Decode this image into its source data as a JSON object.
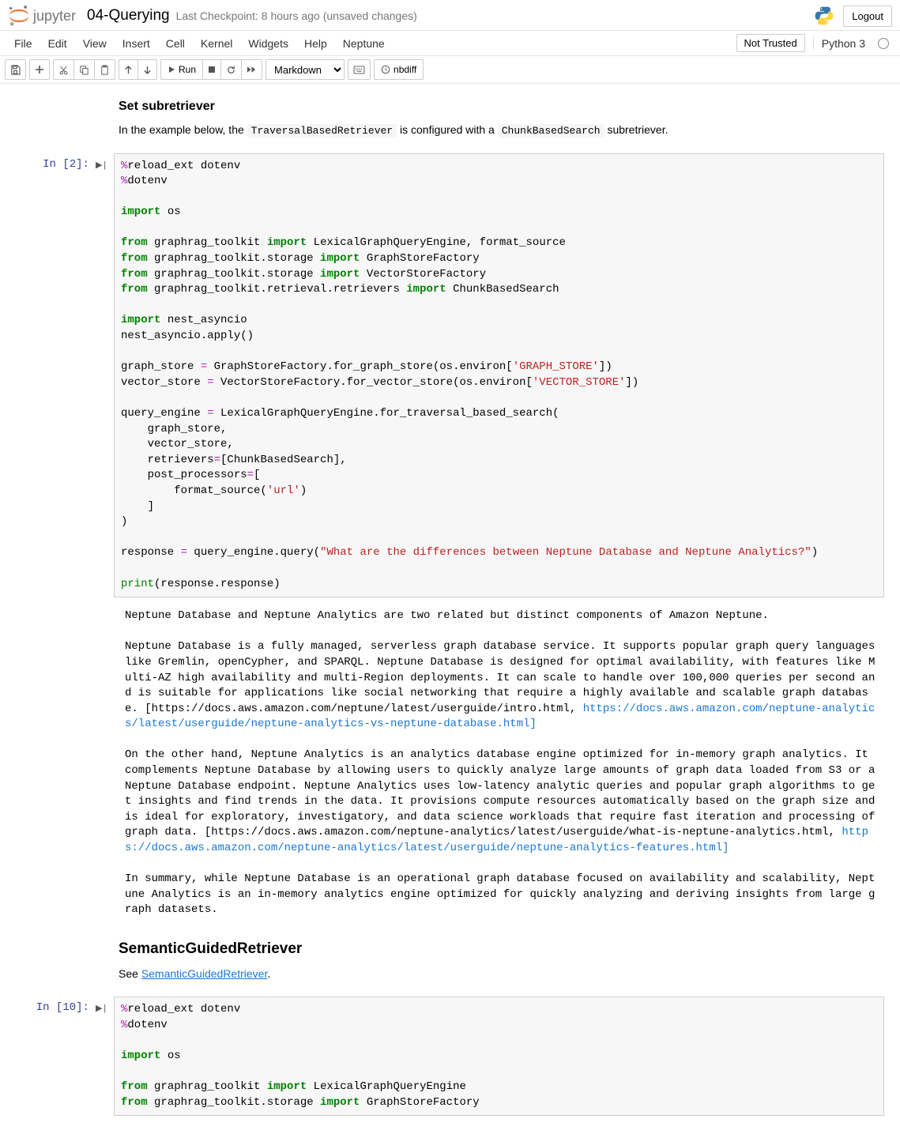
{
  "header": {
    "jupyter": "jupyter",
    "title": "04-Querying",
    "checkpoint": "Last Checkpoint: 8 hours ago",
    "unsaved": "(unsaved changes)",
    "logout": "Logout"
  },
  "menubar": {
    "items": [
      "File",
      "Edit",
      "View",
      "Insert",
      "Cell",
      "Kernel",
      "Widgets",
      "Help",
      "Neptune"
    ],
    "trust": "Not Trusted",
    "kernel": "Python 3"
  },
  "toolbar": {
    "run": "Run",
    "cell_type": "Markdown",
    "nbdiff": "nbdiff"
  },
  "md1": {
    "heading": "Set subretriever",
    "p1a": "In the example below, the ",
    "p1b": "TraversalBasedRetriever",
    "p1c": " is configured with a ",
    "p1d": "ChunkBasedSearch",
    "p1e": " subretriever."
  },
  "cell2": {
    "prompt": "In [2]:",
    "code": {
      "l1a": "%",
      "l1b": "reload_ext dotenv",
      "l2a": "%",
      "l2b": "dotenv",
      "l3a": "import",
      "l3b": " os",
      "l4a": "from",
      "l4b": " graphrag_toolkit ",
      "l4c": "import",
      "l4d": " LexicalGraphQueryEngine, format_source",
      "l5a": "from",
      "l5b": " graphrag_toolkit.storage ",
      "l5c": "import",
      "l5d": " GraphStoreFactory",
      "l6a": "from",
      "l6b": " graphrag_toolkit.storage ",
      "l6c": "import",
      "l6d": " VectorStoreFactory",
      "l7a": "from",
      "l7b": " graphrag_toolkit.retrieval.retrievers ",
      "l7c": "import",
      "l7d": " ChunkBasedSearch",
      "l8a": "import",
      "l8b": " nest_asyncio",
      "l9": "nest_asyncio.apply()",
      "l10a": "graph_store ",
      "l10b": "=",
      "l10c": " GraphStoreFactory.for_graph_store(os.environ[",
      "l10d": "'GRAPH_STORE'",
      "l10e": "])",
      "l11a": "vector_store ",
      "l11b": "=",
      "l11c": " VectorStoreFactory.for_vector_store(os.environ[",
      "l11d": "'VECTOR_STORE'",
      "l11e": "])",
      "l12a": "query_engine ",
      "l12b": "=",
      "l12c": " LexicalGraphQueryEngine.for_traversal_based_search(",
      "l13": "    graph_store,",
      "l14": "    vector_store,",
      "l15a": "    retrievers",
      "l15b": "=",
      "l15c": "[ChunkBasedSearch],",
      "l16a": "    post_processors",
      "l16b": "=",
      "l16c": "[",
      "l17a": "        format_source(",
      "l17b": "'url'",
      "l17c": ")",
      "l18": "    ]",
      "l19": ")",
      "l20a": "response ",
      "l20b": "=",
      "l20c": " query_engine.query(",
      "l20d": "\"What are the differences between Neptune Database and Neptune Analytics?\"",
      "l20e": ")",
      "l21a": "print",
      "l21b": "(response.response)"
    }
  },
  "output2": {
    "part1": "Neptune Database and Neptune Analytics are two related but distinct components of Amazon Neptune.\n\nNeptune Database is a fully managed, serverless graph database service. It supports popular graph query languages like Gremlin, openCypher, and SPARQL. Neptune Database is designed for optimal availability, with features like Multi-AZ high availability and multi-Region deployments. It can scale to handle over 100,000 queries per second and is suitable for applications like social networking that require a highly available and scalable graph database. [https://docs.aws.amazon.com/neptune/latest/userguide/intro.html, ",
    "link1": "https://docs.aws.amazon.com/neptune-analytics/latest/userguide/neptune-analytics-vs-neptune-database.html]",
    "part2": "\n\nOn the other hand, Neptune Analytics is an analytics database engine optimized for in-memory graph analytics. It complements Neptune Database by allowing users to quickly analyze large amounts of graph data loaded from S3 or a Neptune Database endpoint. Neptune Analytics uses low-latency analytic queries and popular graph algorithms to get insights and find trends in the data. It provisions compute resources automatically based on the graph size and is ideal for exploratory, investigatory, and data science workloads that require fast iteration and processing of graph data. [https://docs.aws.amazon.com/neptune-analytics/latest/userguide/what-is-neptune-analytics.html, ",
    "link2": "https://docs.aws.amazon.com/neptune-analytics/latest/userguide/neptune-analytics-features.html]",
    "part3": "\n\nIn summary, while Neptune Database is an operational graph database focused on availability and scalability, Neptune Analytics is an in-memory analytics engine optimized for quickly analyzing and deriving insights from large graph datasets."
  },
  "md2": {
    "heading": "SemanticGuidedRetriever",
    "p1a": "See ",
    "p1b": "SemanticGuidedRetriever",
    "p1c": "."
  },
  "cell10": {
    "prompt": "In [10]:",
    "code": {
      "l1a": "%",
      "l1b": "reload_ext dotenv",
      "l2a": "%",
      "l2b": "dotenv",
      "l3a": "import",
      "l3b": " os",
      "l4a": "from",
      "l4b": " graphrag_toolkit ",
      "l4c": "import",
      "l4d": " LexicalGraphQueryEngine",
      "l5a": "from",
      "l5b": " graphrag_toolkit.storage ",
      "l5c": "import",
      "l5d": " GraphStoreFactory"
    }
  }
}
